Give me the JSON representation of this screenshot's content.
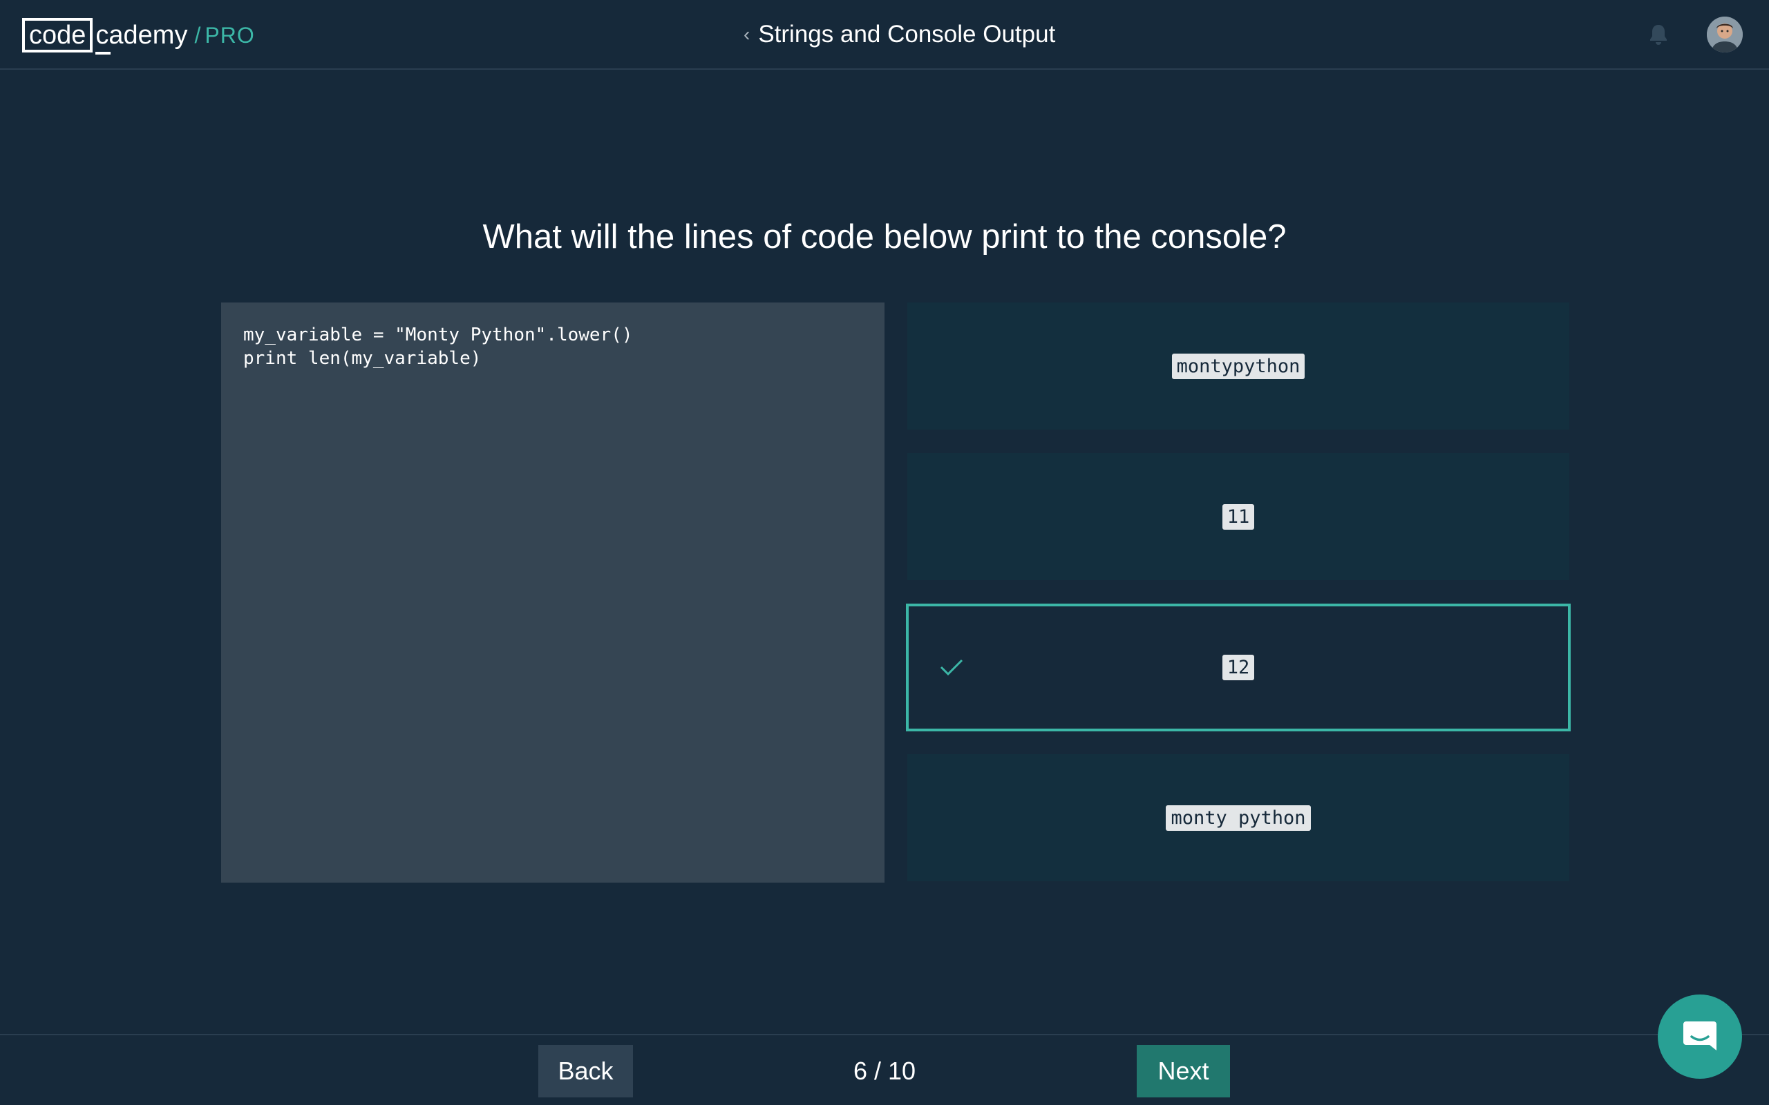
{
  "header": {
    "logo": {
      "boxed": "code",
      "rest": "cademy",
      "slash": "/",
      "tier": "PRO"
    },
    "breadcrumb_title": "Strings and Console Output",
    "icons": {
      "back": "chevron-left-icon",
      "notifications": "bell-icon",
      "profile": "avatar"
    }
  },
  "question": {
    "text": "What will the lines of code below print to the console?"
  },
  "code": {
    "lines": [
      "my_variable = \"Monty Python\".lower()",
      "print len(my_variable)"
    ]
  },
  "answers": [
    {
      "label": "montypython",
      "selected": false
    },
    {
      "label": "11",
      "selected": false
    },
    {
      "label": "12",
      "selected": true
    },
    {
      "label": "monty python",
      "selected": false
    }
  ],
  "footer": {
    "back_label": "Back",
    "progress": "6 / 10",
    "next_label": "Next"
  },
  "colors": {
    "background": "#16293a",
    "accent": "#3cb7a7",
    "next_button": "#21786e",
    "code_panel": "#354553",
    "answer_card": "#132f3e"
  }
}
